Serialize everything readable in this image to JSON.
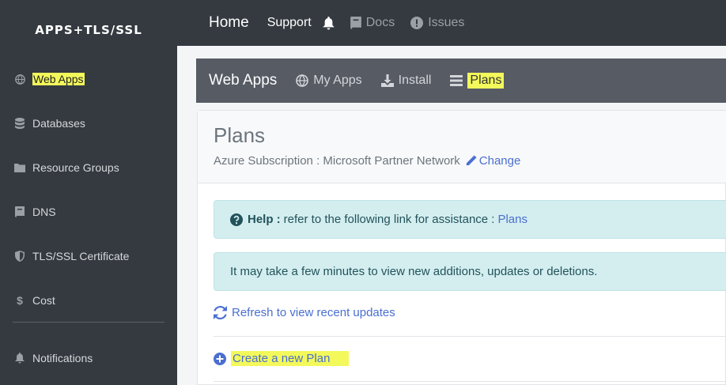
{
  "brand": "APPS+TLS/SSL",
  "sidebar": {
    "items": [
      {
        "label": "Web Apps",
        "icon": "globe-icon"
      },
      {
        "label": "Databases",
        "icon": "database-icon"
      },
      {
        "label": "Resource Groups",
        "icon": "folder-icon"
      },
      {
        "label": "DNS",
        "icon": "book-icon"
      },
      {
        "label": "TLS/SSL Certificate",
        "icon": "shield-icon"
      },
      {
        "label": "Cost",
        "icon": "dollar-icon"
      },
      {
        "label": "Notifications",
        "icon": "bell-icon"
      }
    ]
  },
  "topbar": {
    "home": "Home",
    "support": "Support",
    "docs": "Docs",
    "issues": "Issues"
  },
  "subnav": {
    "title": "Web Apps",
    "my_apps": "My Apps",
    "install": "Install",
    "plans": "Plans"
  },
  "card": {
    "title": "Plans",
    "subscription_text": "Azure Subscription : Microsoft Partner Network",
    "change_label": "Change",
    "help_bold": "Help :",
    "help_text": "refer to the following link for assistance :",
    "help_link": "Plans",
    "notice_text": "It may take a few minutes to view new additions, updates or deletions.",
    "refresh_label": "Refresh to view recent updates",
    "create_label": "Create a new Plan"
  },
  "colors": {
    "sidebar_bg": "#343a40",
    "subnav_bg": "#565b64",
    "highlight": "#f3f95a",
    "link": "#4a6fd0",
    "alert_bg": "#d4eef0"
  }
}
